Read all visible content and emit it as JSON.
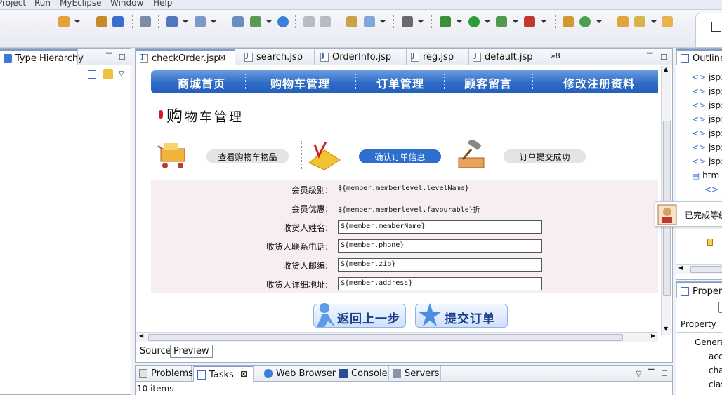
{
  "menu": [
    "Project",
    "Run",
    "MyEclipse",
    "Window",
    "Help"
  ],
  "left_panel": {
    "tab_label": "Type Hierarchy"
  },
  "editor": {
    "tabs": [
      "checkOrder.jsp",
      "search.jsp",
      "OrderInfo.jsp",
      "reg.jsp",
      "default.jsp"
    ],
    "overflow_count": "»8",
    "bottom_tabs": [
      "Source",
      "Preview"
    ],
    "nav": [
      "商城首页",
      "购物车管理",
      "订单管理",
      "顾客留言",
      "修改注册资料"
    ],
    "page_title_first": "购",
    "page_title_rest": "物车管理",
    "steps": [
      "查看购物车物品",
      "确认订单信息",
      "订单提交成功"
    ],
    "form": [
      {
        "label": "会员级别:",
        "value": "${member.memberlevel.levelName}"
      },
      {
        "label": "会员优惠:",
        "value": "${member.memberlevel.favourable}折"
      },
      {
        "label": "收货人姓名:",
        "value": "${member.memberName}"
      },
      {
        "label": "收货人联系电话:",
        "value": "${member.phone}"
      },
      {
        "label": "收货人邮编:",
        "value": "${member.zip}"
      },
      {
        "label": "收货人详细地址:",
        "value": "${member.address}"
      }
    ],
    "buttons": {
      "back": "返回上一步",
      "submit": "提交订单"
    }
  },
  "bottom_panel": {
    "tabs": [
      "Problems",
      "Tasks",
      "Web Browser",
      "Console",
      "Servers"
    ],
    "status": "10 items"
  },
  "outline": {
    "tab_label": "Outline",
    "items": [
      "jsp:",
      "jsp:",
      "jsp:",
      "jsp:",
      "jsp:",
      "jsp:",
      "jsp:",
      "htm"
    ],
    "popup": "已完成等级"
  },
  "properties": {
    "tab_label": "Propert",
    "column": "Property",
    "rows": [
      "Genera",
      "acc",
      "cha",
      "clas"
    ]
  },
  "colors": {
    "nav_blue": "#2f6dc8",
    "active_step": "#2c6fcd",
    "form_bg": "#f6eef1"
  }
}
